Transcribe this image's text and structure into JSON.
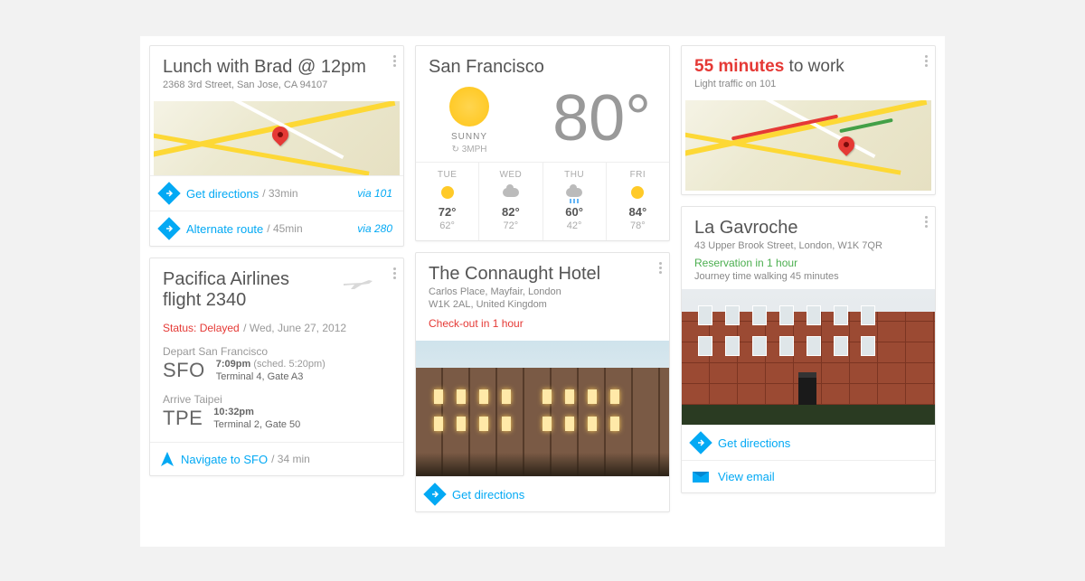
{
  "lunch": {
    "title": "Lunch with Brad @ 12pm",
    "address": "2368 3rd Street, San Jose, CA 94107",
    "dir1_label": "Get directions",
    "dir1_time": "/ 33min",
    "dir1_via": "via 101",
    "dir2_label": "Alternate route",
    "dir2_time": "/ 45min",
    "dir2_via": "via 280"
  },
  "flight": {
    "title1": "Pacifica Airlines",
    "title2": "flight 2340",
    "status_label": "Status: Delayed",
    "status_sep": "  /  ",
    "date": "Wed, June 27, 2012",
    "depart_label": "Depart San Francisco",
    "depart_code": "SFO",
    "depart_time": "7:09pm",
    "depart_sched": "(sched. 5:20pm)",
    "depart_gate": "Terminal 4, Gate A3",
    "arrive_label": "Arrive Taipei",
    "arrive_code": "TPE",
    "arrive_time": "10:32pm",
    "arrive_gate": "Terminal 2, Gate 50",
    "nav_label": "Navigate to SFO",
    "nav_time": "/  34 min"
  },
  "weather": {
    "city": "San Francisco",
    "cond": "SUNNY",
    "wind": "3MPH",
    "temp": "80°",
    "days": [
      {
        "d": "TUE",
        "hi": "72°",
        "lo": "62°",
        "icon": "sun"
      },
      {
        "d": "WED",
        "hi": "82°",
        "lo": "72°",
        "icon": "cloud"
      },
      {
        "d": "THU",
        "hi": "60°",
        "lo": "42°",
        "icon": "rain"
      },
      {
        "d": "FRI",
        "hi": "84°",
        "lo": "78°",
        "icon": "sun"
      }
    ]
  },
  "hotel": {
    "title": "The Connaught Hotel",
    "addr1": "Carlos Place, Mayfair, London",
    "addr2": "W1K 2AL, United Kingdom",
    "note": "Check-out in 1 hour",
    "dir": "Get directions"
  },
  "commute": {
    "minutes": "55 minutes",
    "rest": " to work",
    "sub": "Light traffic on 101"
  },
  "rest": {
    "title": "La Gavroche",
    "addr": "43 Upper Brook Street, London, W1K 7QR",
    "res": "Reservation in 1 hour",
    "journey": "Journey time walking 45 minutes",
    "dir": "Get directions",
    "email": "View email"
  }
}
